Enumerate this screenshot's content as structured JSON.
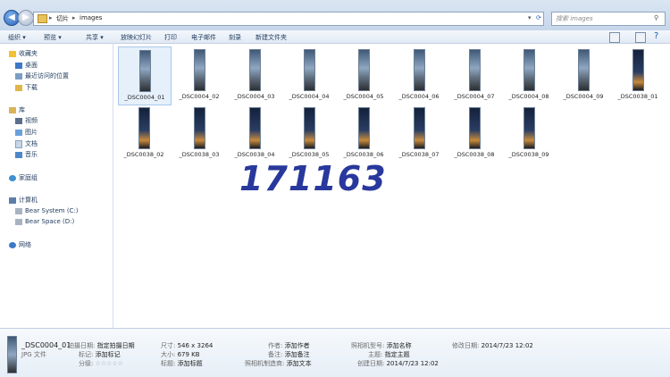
{
  "address": {
    "seg1": "切片",
    "seg2": "images"
  },
  "search": {
    "placeholder": "搜索 images"
  },
  "toolbar": {
    "organize": "组织 ▾",
    "preview": "预览 ▾",
    "share": "共享 ▾",
    "slideshow": "放映幻灯片",
    "print": "打印",
    "email": "电子邮件",
    "burn": "刻录",
    "new_folder": "新建文件夹"
  },
  "sidebar": {
    "favorites": "收藏夹",
    "desktop": "桌面",
    "recent": "最近访问的位置",
    "downloads": "下载",
    "libraries": "库",
    "videos": "视频",
    "pictures": "图片",
    "documents": "文档",
    "music": "音乐",
    "homegroup": "家庭组",
    "computer": "计算机",
    "drive_c": "Bear System (C:)",
    "drive_d": "Bear Space (D:)",
    "network": "网络"
  },
  "files": [
    "_DSC0004_01",
    "_DSC0004_02",
    "_DSC0004_03",
    "_DSC0004_04",
    "_DSC0004_05",
    "_DSC0004_06",
    "_DSC0004_07",
    "_DSC0004_08",
    "_DSC0004_09",
    "_DSC0038_01",
    "_DSC0038_02",
    "_DSC0038_03",
    "_DSC0038_04",
    "_DSC0038_05",
    "_DSC0038_06",
    "_DSC0038_07",
    "_DSC0038_08",
    "_DSC0038_09"
  ],
  "watermark": "171163",
  "details": {
    "name": "_DSC0004_01",
    "type": "JPG 文件",
    "date_taken_label": "拍摄日期:",
    "date_taken": "指定拍摄日期",
    "tags_label": "标记:",
    "tags": "添加标记",
    "rating_label": "分级:",
    "rating": "☆☆☆☆☆",
    "dims_label": "尺寸:",
    "dims": "546 x 3264",
    "size_label": "大小:",
    "size": "679 KB",
    "title_label": "标题:",
    "title": "添加标题",
    "author_label": "作者:",
    "author": "添加作者",
    "comments_label": "备注:",
    "comments": "添加备注",
    "maker_label": "照相机制造商:",
    "maker": "添加文本",
    "model_label": "照相机型号:",
    "model": "添加名称",
    "subject_label": "主题:",
    "subject": "指定主题",
    "created_label": "创建日期:",
    "created": "2014/7/23 12:02",
    "modified_label": "修改日期:",
    "modified": "2014/7/23 12:02"
  }
}
